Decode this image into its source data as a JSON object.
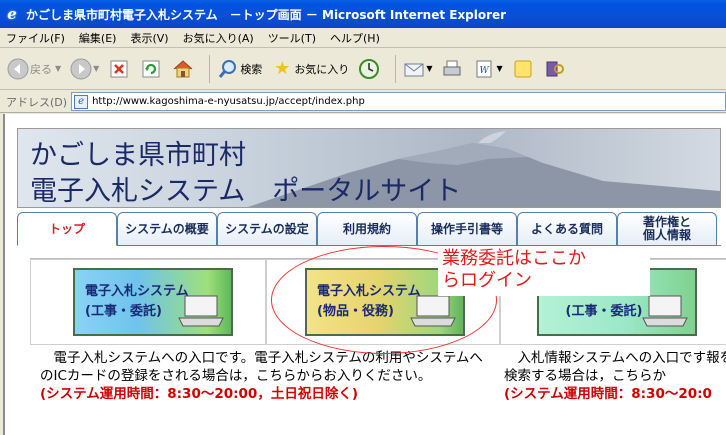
{
  "window": {
    "title": "かごしま県市町村電子入札システム　－トップ画面 － Microsoft Internet Explorer"
  },
  "menu": [
    "ファイル(F)",
    "編集(E)",
    "表示(V)",
    "お気に入り(A)",
    "ツール(T)",
    "ヘルプ(H)"
  ],
  "toolbar": {
    "back": "戻る",
    "search": "検索",
    "favorites": "お気に入り"
  },
  "address": {
    "label": "アドレス(D)",
    "url": "http://www.kagoshima-e-nyusatsu.jp/accept/index.php"
  },
  "banner": {
    "line1": "かごしま県市町村",
    "line2": "電子入札システム　ポータルサイト"
  },
  "tabs": [
    {
      "label": "トップ",
      "active": true
    },
    {
      "label": "システムの概要"
    },
    {
      "label": "システムの設定"
    },
    {
      "label": "利用規約"
    },
    {
      "label": "操作手引書等"
    },
    {
      "label": "よくある質問"
    },
    {
      "label1": "著作権と",
      "label2": "個人情報"
    }
  ],
  "buttons": {
    "a": {
      "line1": "電子入札システム",
      "line2": "(工事・委託)"
    },
    "b": {
      "line1": "電子入札システム",
      "line2": "(物品・役務)"
    },
    "c": {
      "line1": "ス",
      "line2": "(工事・委託)"
    }
  },
  "desc_left": {
    "text": "　電子入札システムへの入口です。電子入札システムの利用やシステムへのICカードの登録をされる場合は，こちらからお入りください。",
    "hours": "(システム運用時間：8:30～20:00，土日祝日除く)"
  },
  "desc_right": {
    "text": "　入札情報システムへの入口です報を検索する場合は，こちらか",
    "hours": "(システム運用時間：8:30～20:0"
  },
  "annotation": {
    "line1": "業務委託はここか",
    "line2": "らログイン"
  }
}
